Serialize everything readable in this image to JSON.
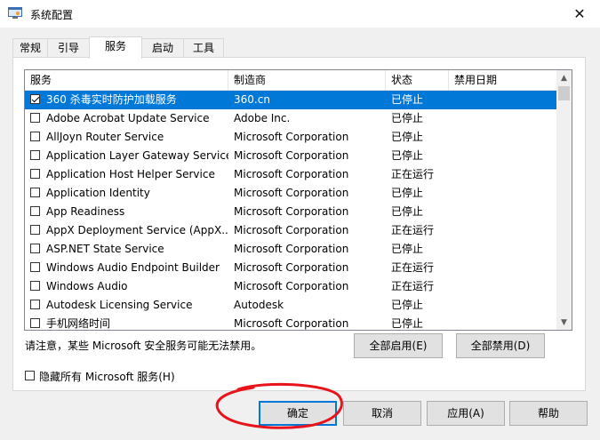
{
  "window": {
    "title": "系统配置",
    "close_glyph": "✕",
    "icon": "settings-window-icon"
  },
  "tabs": [
    {
      "label": "常规",
      "active": false
    },
    {
      "label": "引导",
      "active": false
    },
    {
      "label": "服务",
      "active": true
    },
    {
      "label": "启动",
      "active": false
    },
    {
      "label": "工具",
      "active": false
    }
  ],
  "services": {
    "columns": [
      "服务",
      "制造商",
      "状态",
      "禁用日期"
    ],
    "rows": [
      {
        "name": "360 杀毒实时防护加载服务",
        "maker": "360.cn",
        "status": "已停止",
        "date": "",
        "checked": true,
        "selected": true
      },
      {
        "name": "Adobe Acrobat Update Service",
        "maker": "Adobe Inc.",
        "status": "已停止",
        "date": "",
        "checked": false,
        "selected": false
      },
      {
        "name": "AllJoyn Router Service",
        "maker": "Microsoft Corporation",
        "status": "已停止",
        "date": "",
        "checked": false,
        "selected": false
      },
      {
        "name": "Application Layer Gateway Service",
        "maker": "Microsoft Corporation",
        "status": "已停止",
        "date": "",
        "checked": false,
        "selected": false
      },
      {
        "name": "Application Host Helper Service",
        "maker": "Microsoft Corporation",
        "status": "正在运行",
        "date": "",
        "checked": false,
        "selected": false
      },
      {
        "name": "Application Identity",
        "maker": "Microsoft Corporation",
        "status": "已停止",
        "date": "",
        "checked": false,
        "selected": false
      },
      {
        "name": "App Readiness",
        "maker": "Microsoft Corporation",
        "status": "已停止",
        "date": "",
        "checked": false,
        "selected": false
      },
      {
        "name": "AppX Deployment Service (AppX...",
        "maker": "Microsoft Corporation",
        "status": "正在运行",
        "date": "",
        "checked": false,
        "selected": false
      },
      {
        "name": "ASP.NET State Service",
        "maker": "Microsoft Corporation",
        "status": "已停止",
        "date": "",
        "checked": false,
        "selected": false
      },
      {
        "name": "Windows Audio Endpoint Builder",
        "maker": "Microsoft Corporation",
        "status": "正在运行",
        "date": "",
        "checked": false,
        "selected": false
      },
      {
        "name": "Windows Audio",
        "maker": "Microsoft Corporation",
        "status": "正在运行",
        "date": "",
        "checked": false,
        "selected": false
      },
      {
        "name": "Autodesk Licensing Service",
        "maker": "Autodesk",
        "status": "已停止",
        "date": "",
        "checked": false,
        "selected": false
      },
      {
        "name": "手机网络时间",
        "maker": "Microsoft Corporation",
        "status": "已停止",
        "date": "",
        "checked": false,
        "selected": false
      }
    ]
  },
  "note": "请注意，某些 Microsoft 安全服务可能无法禁用。",
  "buttons": {
    "enable_all": "全部启用(E)",
    "disable_all": "全部禁用(D)",
    "ok": "确定",
    "cancel": "取消",
    "apply": "应用(A)",
    "help": "帮助"
  },
  "hide_ms": {
    "label": "隐藏所有 Microsoft 服务(H)",
    "checked": false
  },
  "colors": {
    "selection": "#0078d7",
    "annotation": "#e8141c",
    "default_button_border": "#0078d7"
  }
}
